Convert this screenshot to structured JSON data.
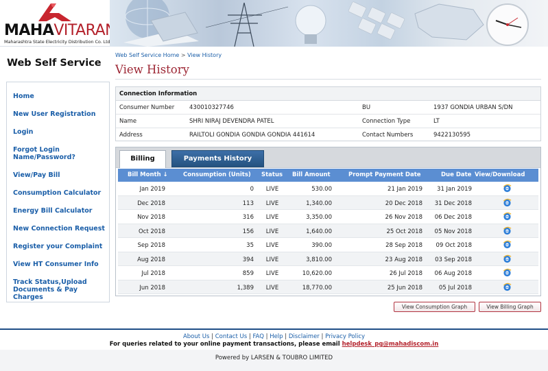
{
  "brand": {
    "logo_main": "MAHA",
    "logo_accent": "VITARAN",
    "logo_subtitle": "Maharashtra State Electricity Distribution Co. Ltd."
  },
  "site_title": "Web Self Service",
  "breadcrumb": {
    "home": "Web Self Service Home",
    "separator": ">",
    "current": "View History"
  },
  "page_title": "View History",
  "sidebar": {
    "items": [
      {
        "label": "Home"
      },
      {
        "label": "New User Registration"
      },
      {
        "label": "Login"
      },
      {
        "label": "Forgot Login Name/Password?"
      },
      {
        "label": "View/Pay Bill"
      },
      {
        "label": "Consumption Calculator"
      },
      {
        "label": "Energy Bill Calculator"
      },
      {
        "label": "New Connection Request"
      },
      {
        "label": "Register your Complaint"
      },
      {
        "label": "View HT Consumer Info"
      },
      {
        "label": "Track Status,Upload Documents & Pay Charges"
      }
    ]
  },
  "connection": {
    "heading": "Connection Information",
    "consumer_number_label": "Consumer Number",
    "consumer_number": "430010327746",
    "bu_label": "BU",
    "bu": "1937 GONDIA URBAN S/DN",
    "name_label": "Name",
    "name": "SHRI NIRAJ DEVENDRA PATEL",
    "connection_type_label": "Connection Type",
    "connection_type": "LT",
    "address_label": "Address",
    "address": "RAILTOLI GONDIA GONDIA GONDIA 441614",
    "contact_label": "Contact Numbers",
    "contact": "9422130595"
  },
  "tabs": {
    "billing": "Billing",
    "payments": "Payments History"
  },
  "bill_table": {
    "headers": {
      "month": "Bill Month ↓",
      "consumption": "Consumption (Units)",
      "status": "Status",
      "amount": "Bill Amount",
      "prompt": "Prompt Payment Date",
      "due": "Due Date",
      "view": "View/Download"
    },
    "rows": [
      {
        "month": "Jan 2019",
        "consumption": "0",
        "status": "LIVE",
        "amount": "530.00",
        "prompt": "21 Jan 2019",
        "due": "31 Jan 2019"
      },
      {
        "month": "Dec 2018",
        "consumption": "113",
        "status": "LIVE",
        "amount": "1,340.00",
        "prompt": "20 Dec 2018",
        "due": "31 Dec 2018"
      },
      {
        "month": "Nov 2018",
        "consumption": "316",
        "status": "LIVE",
        "amount": "3,350.00",
        "prompt": "26 Nov 2018",
        "due": "06 Dec 2018"
      },
      {
        "month": "Oct 2018",
        "consumption": "156",
        "status": "LIVE",
        "amount": "1,640.00",
        "prompt": "25 Oct 2018",
        "due": "05 Nov 2018"
      },
      {
        "month": "Sep 2018",
        "consumption": "35",
        "status": "LIVE",
        "amount": "390.00",
        "prompt": "28 Sep 2018",
        "due": "09 Oct 2018"
      },
      {
        "month": "Aug 2018",
        "consumption": "394",
        "status": "LIVE",
        "amount": "3,810.00",
        "prompt": "23 Aug 2018",
        "due": "03 Sep 2018"
      },
      {
        "month": "Jul 2018",
        "consumption": "859",
        "status": "LIVE",
        "amount": "10,620.00",
        "prompt": "26 Jul 2018",
        "due": "06 Aug 2018"
      },
      {
        "month": "Jun 2018",
        "consumption": "1,389",
        "status": "LIVE",
        "amount": "18,770.00",
        "prompt": "25 Jun 2018",
        "due": "05 Jul 2018"
      }
    ]
  },
  "buttons": {
    "consumption_graph": "View Consumption Graph",
    "billing_graph": "View Billing Graph"
  },
  "footer": {
    "links": [
      "About Us",
      "Contact Us",
      "FAQ",
      "Help",
      "Disclaimer",
      "Privacy Policy"
    ],
    "link_separator": "|",
    "query_text": "For queries related to your online payment transactions, please email",
    "email": "helpdesk_pg@mahadiscom.in",
    "powered_by": "Powered by LARSEN & TOUBRO LIMITED"
  },
  "icons": {
    "download": "ie-browser-icon",
    "brand": "lightning-bolt-logo"
  },
  "colors": {
    "brand_red": "#b3202a",
    "link_blue": "#1a5ea8",
    "title_maroon": "#9c2533",
    "grid_header": "#5b8ed2",
    "tab_active_blue": "#2d5f91"
  }
}
